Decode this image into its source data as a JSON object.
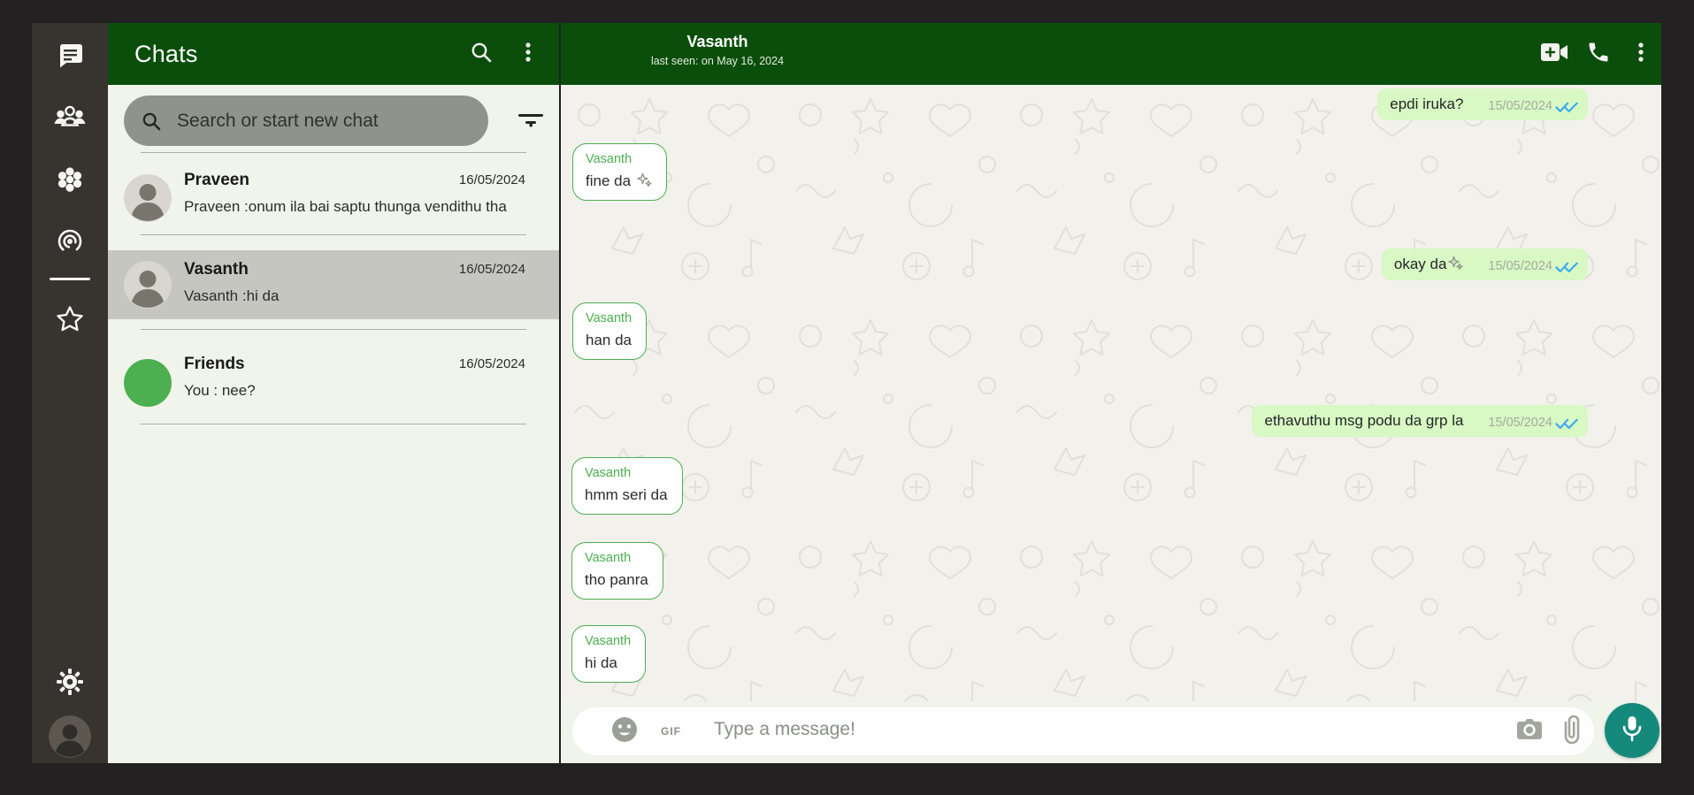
{
  "colors": {
    "header_green": "#0b4e0c",
    "accent_green": "#4caf50",
    "outgoing_bubble": "#d8f8c4",
    "incoming_border": "#4caf50",
    "mic_teal": "#14897c",
    "tick_blue": "#3aa8f0",
    "selected_row_gray": "#c6c6c1",
    "friends_avatar_green": "#4caf50"
  },
  "rail": {
    "items": [
      {
        "id": "chats",
        "icon": "chat-bubble-icon"
      },
      {
        "id": "groups",
        "icon": "groups-icon"
      },
      {
        "id": "communities",
        "icon": "community-icon"
      },
      {
        "id": "status",
        "icon": "status-icon"
      },
      {
        "id": "starred",
        "icon": "star-icon"
      }
    ],
    "settings_icon": "gear-icon",
    "profile_icon": "profile-avatar"
  },
  "chat_list": {
    "title": "Chats",
    "search_placeholder": "Search or start new chat",
    "chats": [
      {
        "name": "Praveen",
        "date": "16/05/2024",
        "preview": "Praveen :onum ila bai saptu thunga vendithu tha",
        "avatar": "photo",
        "selected": false
      },
      {
        "name": "Vasanth",
        "date": "16/05/2024",
        "preview": "Vasanth :hi da",
        "avatar": "photo",
        "selected": true
      },
      {
        "name": "Friends",
        "date": "16/05/2024",
        "preview": "You : nee?",
        "avatar": "green",
        "selected": false
      }
    ]
  },
  "conversation": {
    "title": "Vasanth",
    "subtitle": "last seen: on May 16, 2024",
    "messages": [
      {
        "direction": "out",
        "text": "epdi iruka?",
        "date": "15/05/2024",
        "status": "read"
      },
      {
        "direction": "in",
        "sender": "Vasanth",
        "text": "fine da ✨"
      },
      {
        "direction": "out",
        "text": "okay da✨",
        "date": "15/05/2024",
        "status": "read"
      },
      {
        "direction": "in",
        "sender": "Vasanth",
        "text": "han da"
      },
      {
        "direction": "out",
        "text": "ethavuthu msg podu da grp la",
        "date": "15/05/2024",
        "status": "read"
      },
      {
        "direction": "in",
        "sender": "Vasanth",
        "text": "hmm seri da"
      },
      {
        "direction": "in",
        "sender": "Vasanth",
        "text": "tho panra"
      },
      {
        "direction": "in",
        "sender": "Vasanth",
        "text": "hi da"
      }
    ],
    "composer": {
      "placeholder": "Type a message!",
      "gif_label": "GIF"
    }
  }
}
